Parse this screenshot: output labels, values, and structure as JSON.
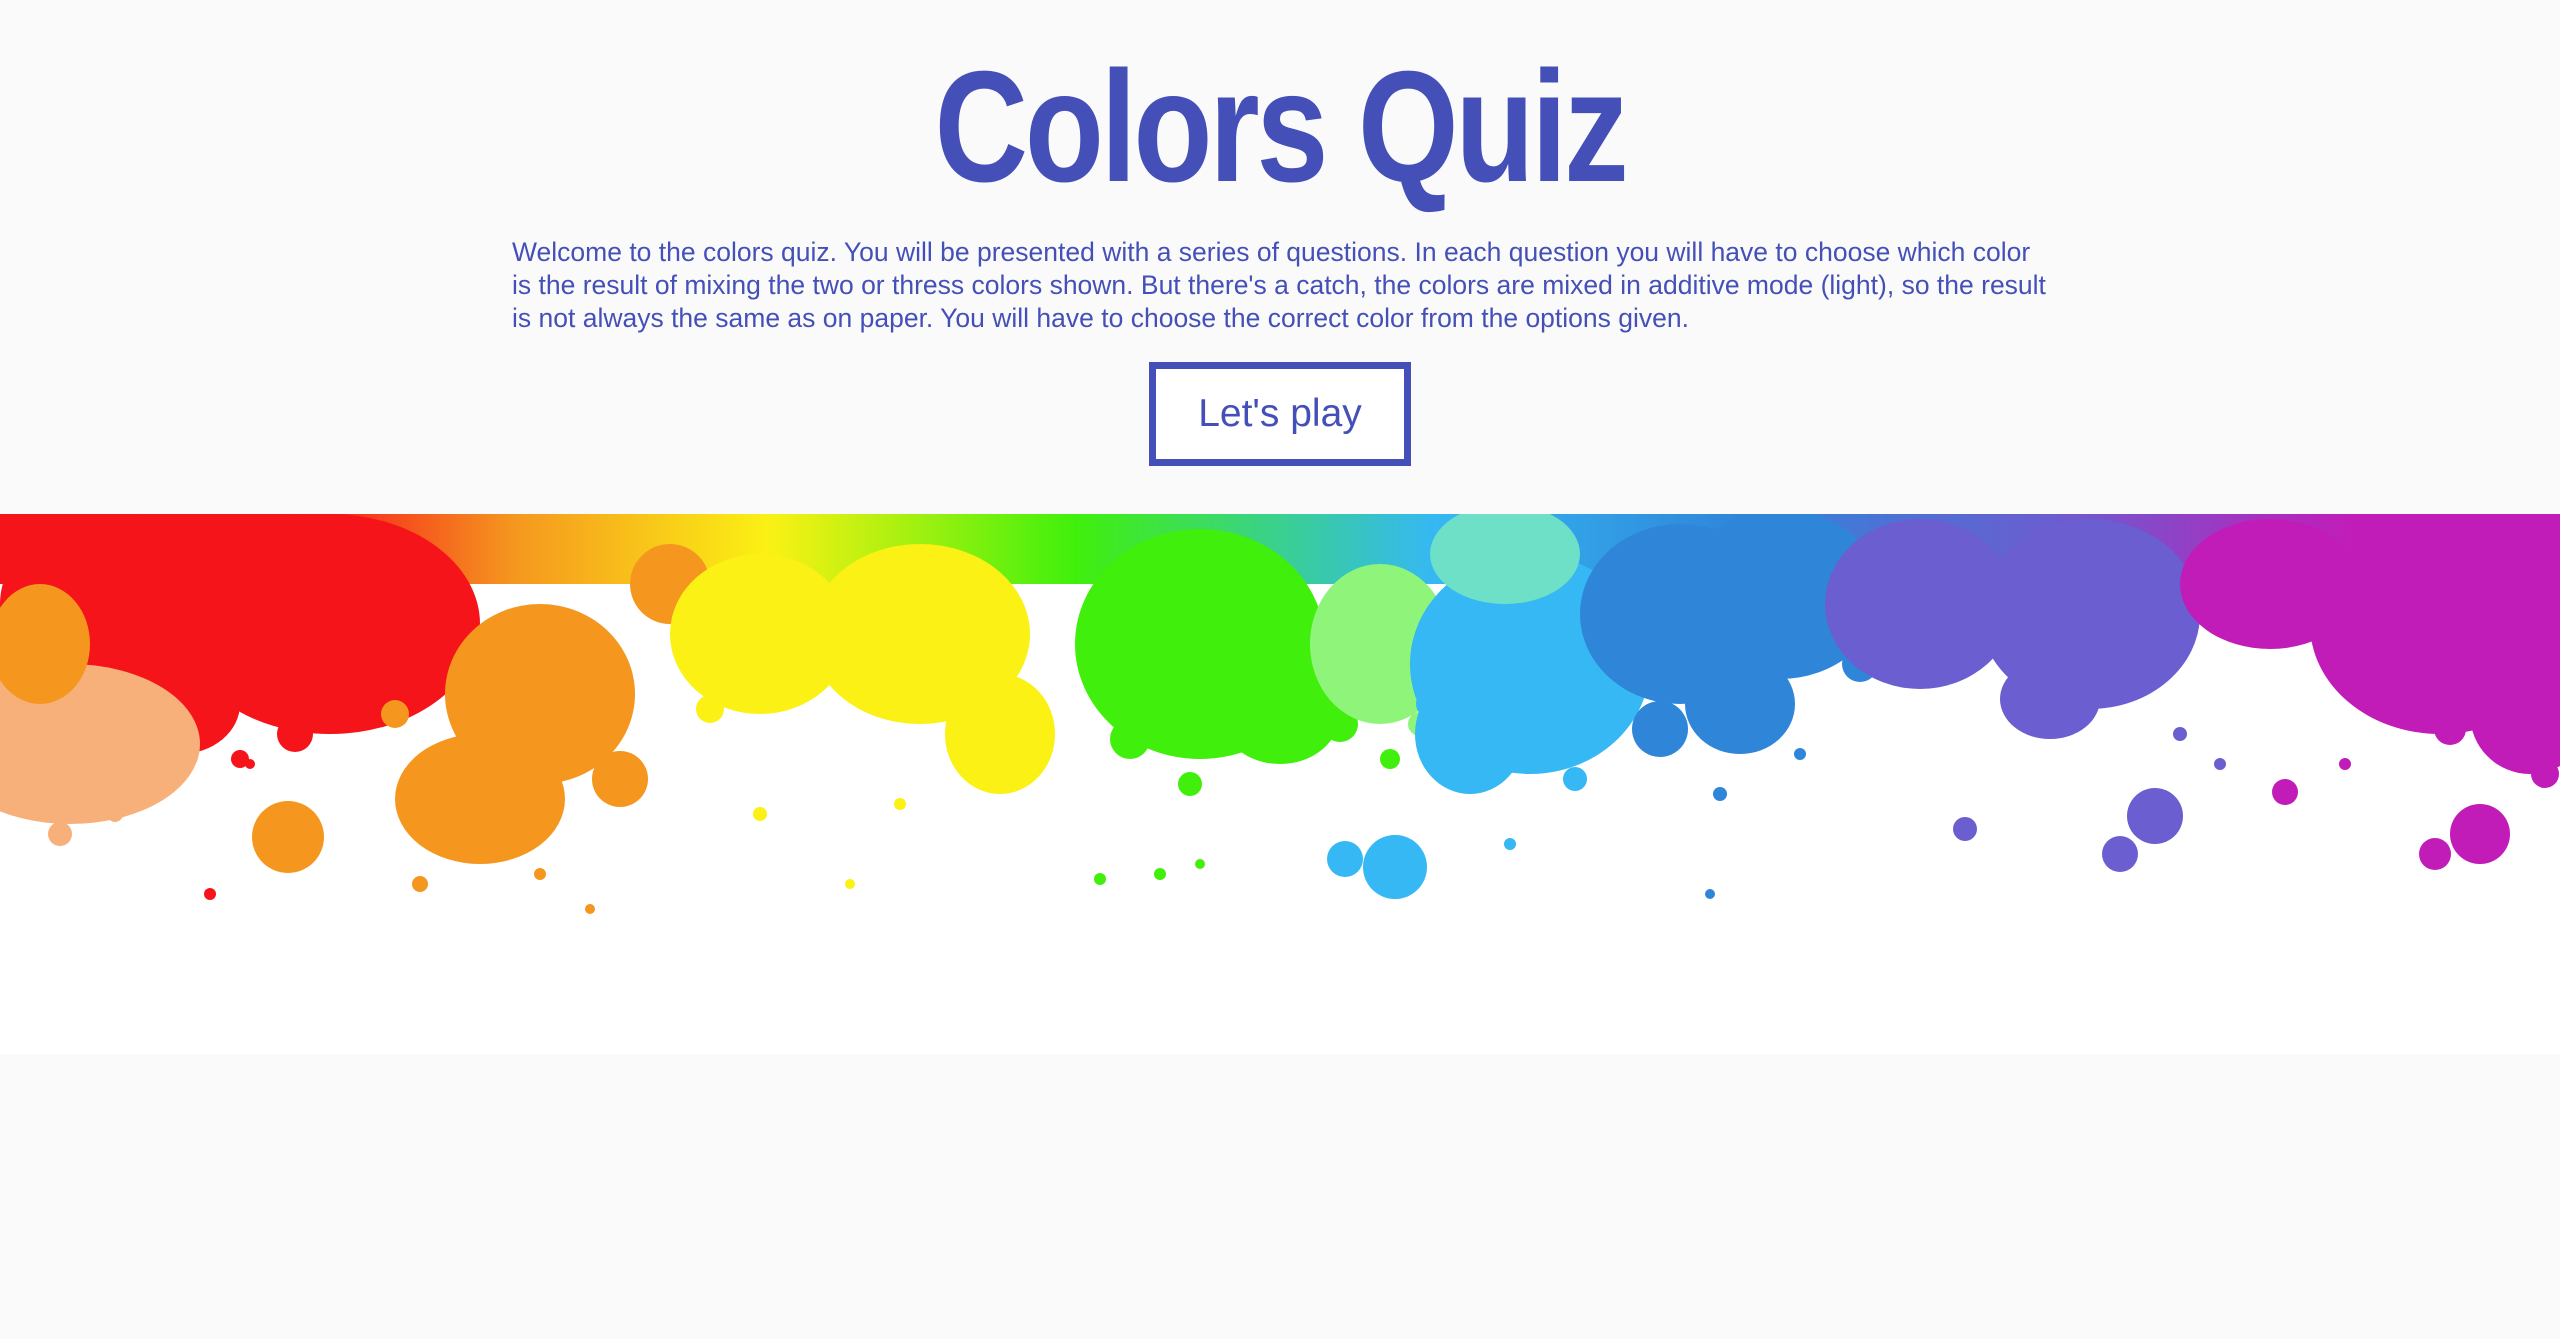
{
  "header": {
    "title": "Colors Quiz"
  },
  "intro": {
    "text": "Welcome to the colors quiz. You will be presented with a series of questions. In each question you will have to choose which color is the result of mixing the two or thress colors shown. But there's a catch, the colors are mixed in additive mode (light), so the result is not always the same as on paper. You will have to choose the correct color from the options given."
  },
  "actions": {
    "play_label": "Let's play"
  },
  "theme": {
    "accent": "#4450b8",
    "page_background": "#fafafa",
    "splash_colors": [
      "#f5141a",
      "#f5961f",
      "#fbf114",
      "#40f00c",
      "#35b8f3",
      "#2f86d9",
      "#6a5ed0",
      "#c21cb8"
    ]
  }
}
